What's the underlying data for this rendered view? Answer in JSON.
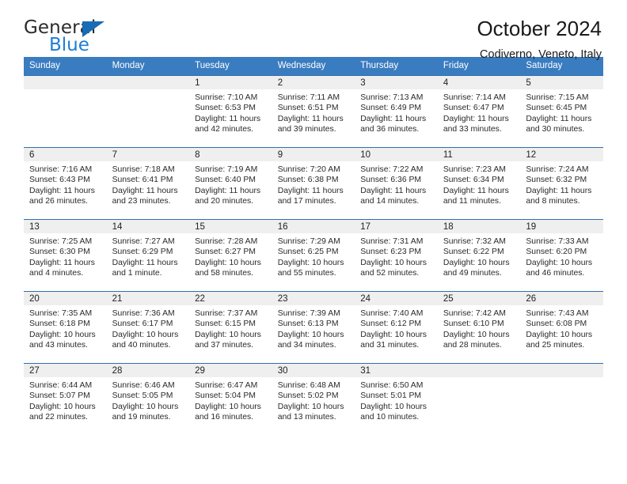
{
  "logo": {
    "primary_text": "General",
    "secondary_text": "Blue",
    "triangle_color": "#1a6bb5",
    "secondary_color": "#1d7fd4"
  },
  "header": {
    "title": "October 2024",
    "subtitle": "Codiverno, Veneto, Italy"
  },
  "theme": {
    "header_bar": "#3a7cc0",
    "row_divider": "#2f6fae",
    "daynum_band": "#efefef"
  },
  "weekdays": [
    "Sunday",
    "Monday",
    "Tuesday",
    "Wednesday",
    "Thursday",
    "Friday",
    "Saturday"
  ],
  "weeks": [
    [
      {
        "day": "",
        "empty": true
      },
      {
        "day": "",
        "empty": true
      },
      {
        "day": "1",
        "sunrise": "Sunrise: 7:10 AM",
        "sunset": "Sunset: 6:53 PM",
        "daylight_1": "Daylight: 11 hours",
        "daylight_2": "and 42 minutes."
      },
      {
        "day": "2",
        "sunrise": "Sunrise: 7:11 AM",
        "sunset": "Sunset: 6:51 PM",
        "daylight_1": "Daylight: 11 hours",
        "daylight_2": "and 39 minutes."
      },
      {
        "day": "3",
        "sunrise": "Sunrise: 7:13 AM",
        "sunset": "Sunset: 6:49 PM",
        "daylight_1": "Daylight: 11 hours",
        "daylight_2": "and 36 minutes."
      },
      {
        "day": "4",
        "sunrise": "Sunrise: 7:14 AM",
        "sunset": "Sunset: 6:47 PM",
        "daylight_1": "Daylight: 11 hours",
        "daylight_2": "and 33 minutes."
      },
      {
        "day": "5",
        "sunrise": "Sunrise: 7:15 AM",
        "sunset": "Sunset: 6:45 PM",
        "daylight_1": "Daylight: 11 hours",
        "daylight_2": "and 30 minutes."
      }
    ],
    [
      {
        "day": "6",
        "sunrise": "Sunrise: 7:16 AM",
        "sunset": "Sunset: 6:43 PM",
        "daylight_1": "Daylight: 11 hours",
        "daylight_2": "and 26 minutes."
      },
      {
        "day": "7",
        "sunrise": "Sunrise: 7:18 AM",
        "sunset": "Sunset: 6:41 PM",
        "daylight_1": "Daylight: 11 hours",
        "daylight_2": "and 23 minutes."
      },
      {
        "day": "8",
        "sunrise": "Sunrise: 7:19 AM",
        "sunset": "Sunset: 6:40 PM",
        "daylight_1": "Daylight: 11 hours",
        "daylight_2": "and 20 minutes."
      },
      {
        "day": "9",
        "sunrise": "Sunrise: 7:20 AM",
        "sunset": "Sunset: 6:38 PM",
        "daylight_1": "Daylight: 11 hours",
        "daylight_2": "and 17 minutes."
      },
      {
        "day": "10",
        "sunrise": "Sunrise: 7:22 AM",
        "sunset": "Sunset: 6:36 PM",
        "daylight_1": "Daylight: 11 hours",
        "daylight_2": "and 14 minutes."
      },
      {
        "day": "11",
        "sunrise": "Sunrise: 7:23 AM",
        "sunset": "Sunset: 6:34 PM",
        "daylight_1": "Daylight: 11 hours",
        "daylight_2": "and 11 minutes."
      },
      {
        "day": "12",
        "sunrise": "Sunrise: 7:24 AM",
        "sunset": "Sunset: 6:32 PM",
        "daylight_1": "Daylight: 11 hours",
        "daylight_2": "and 8 minutes."
      }
    ],
    [
      {
        "day": "13",
        "sunrise": "Sunrise: 7:25 AM",
        "sunset": "Sunset: 6:30 PM",
        "daylight_1": "Daylight: 11 hours",
        "daylight_2": "and 4 minutes."
      },
      {
        "day": "14",
        "sunrise": "Sunrise: 7:27 AM",
        "sunset": "Sunset: 6:29 PM",
        "daylight_1": "Daylight: 11 hours",
        "daylight_2": "and 1 minute."
      },
      {
        "day": "15",
        "sunrise": "Sunrise: 7:28 AM",
        "sunset": "Sunset: 6:27 PM",
        "daylight_1": "Daylight: 10 hours",
        "daylight_2": "and 58 minutes."
      },
      {
        "day": "16",
        "sunrise": "Sunrise: 7:29 AM",
        "sunset": "Sunset: 6:25 PM",
        "daylight_1": "Daylight: 10 hours",
        "daylight_2": "and 55 minutes."
      },
      {
        "day": "17",
        "sunrise": "Sunrise: 7:31 AM",
        "sunset": "Sunset: 6:23 PM",
        "daylight_1": "Daylight: 10 hours",
        "daylight_2": "and 52 minutes."
      },
      {
        "day": "18",
        "sunrise": "Sunrise: 7:32 AM",
        "sunset": "Sunset: 6:22 PM",
        "daylight_1": "Daylight: 10 hours",
        "daylight_2": "and 49 minutes."
      },
      {
        "day": "19",
        "sunrise": "Sunrise: 7:33 AM",
        "sunset": "Sunset: 6:20 PM",
        "daylight_1": "Daylight: 10 hours",
        "daylight_2": "and 46 minutes."
      }
    ],
    [
      {
        "day": "20",
        "sunrise": "Sunrise: 7:35 AM",
        "sunset": "Sunset: 6:18 PM",
        "daylight_1": "Daylight: 10 hours",
        "daylight_2": "and 43 minutes."
      },
      {
        "day": "21",
        "sunrise": "Sunrise: 7:36 AM",
        "sunset": "Sunset: 6:17 PM",
        "daylight_1": "Daylight: 10 hours",
        "daylight_2": "and 40 minutes."
      },
      {
        "day": "22",
        "sunrise": "Sunrise: 7:37 AM",
        "sunset": "Sunset: 6:15 PM",
        "daylight_1": "Daylight: 10 hours",
        "daylight_2": "and 37 minutes."
      },
      {
        "day": "23",
        "sunrise": "Sunrise: 7:39 AM",
        "sunset": "Sunset: 6:13 PM",
        "daylight_1": "Daylight: 10 hours",
        "daylight_2": "and 34 minutes."
      },
      {
        "day": "24",
        "sunrise": "Sunrise: 7:40 AM",
        "sunset": "Sunset: 6:12 PM",
        "daylight_1": "Daylight: 10 hours",
        "daylight_2": "and 31 minutes."
      },
      {
        "day": "25",
        "sunrise": "Sunrise: 7:42 AM",
        "sunset": "Sunset: 6:10 PM",
        "daylight_1": "Daylight: 10 hours",
        "daylight_2": "and 28 minutes."
      },
      {
        "day": "26",
        "sunrise": "Sunrise: 7:43 AM",
        "sunset": "Sunset: 6:08 PM",
        "daylight_1": "Daylight: 10 hours",
        "daylight_2": "and 25 minutes."
      }
    ],
    [
      {
        "day": "27",
        "sunrise": "Sunrise: 6:44 AM",
        "sunset": "Sunset: 5:07 PM",
        "daylight_1": "Daylight: 10 hours",
        "daylight_2": "and 22 minutes."
      },
      {
        "day": "28",
        "sunrise": "Sunrise: 6:46 AM",
        "sunset": "Sunset: 5:05 PM",
        "daylight_1": "Daylight: 10 hours",
        "daylight_2": "and 19 minutes."
      },
      {
        "day": "29",
        "sunrise": "Sunrise: 6:47 AM",
        "sunset": "Sunset: 5:04 PM",
        "daylight_1": "Daylight: 10 hours",
        "daylight_2": "and 16 minutes."
      },
      {
        "day": "30",
        "sunrise": "Sunrise: 6:48 AM",
        "sunset": "Sunset: 5:02 PM",
        "daylight_1": "Daylight: 10 hours",
        "daylight_2": "and 13 minutes."
      },
      {
        "day": "31",
        "sunrise": "Sunrise: 6:50 AM",
        "sunset": "Sunset: 5:01 PM",
        "daylight_1": "Daylight: 10 hours",
        "daylight_2": "and 10 minutes."
      },
      {
        "day": "",
        "empty": true
      },
      {
        "day": "",
        "empty": true
      }
    ]
  ]
}
